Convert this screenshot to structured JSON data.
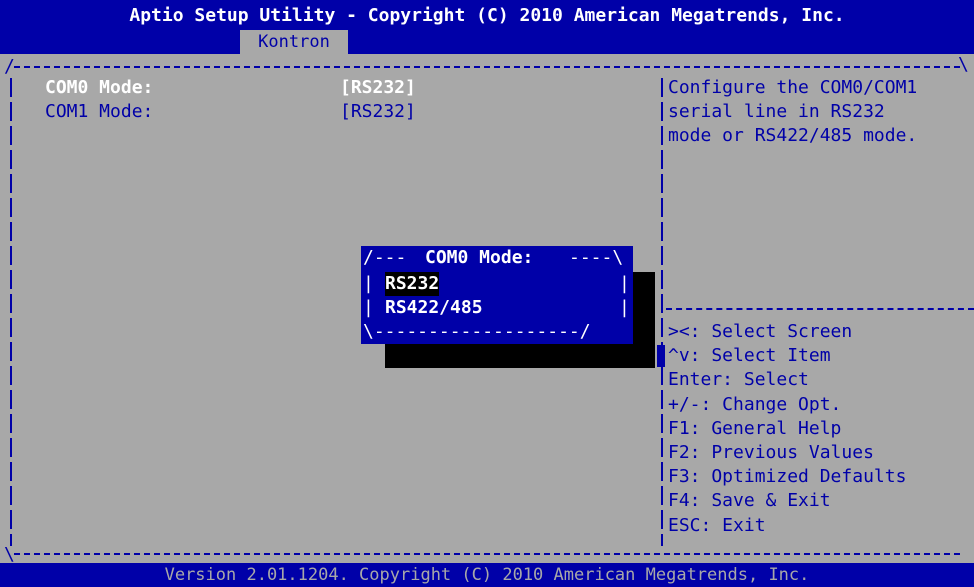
{
  "header": {
    "title": "Aptio Setup Utility - Copyright (C) 2010 American Megatrends, Inc.",
    "tab": "Kontron"
  },
  "settings": [
    {
      "label": "COM0 Mode:",
      "value": "[RS232]"
    },
    {
      "label": "COM1 Mode:",
      "value": "[RS232]"
    }
  ],
  "help": {
    "lines": [
      "Configure the COM0/COM1",
      "serial line in RS232",
      "mode or RS422/485 mode."
    ]
  },
  "keys": [
    "><: Select Screen",
    "^v: Select Item",
    "Enter: Select",
    "+/-: Change Opt.",
    "F1: General Help",
    "F2: Previous Values",
    "F3: Optimized Defaults",
    "F4: Save & Exit",
    "ESC: Exit"
  ],
  "popup": {
    "title": "COM0 Mode:",
    "options": [
      "RS232",
      "RS422/485"
    ],
    "selected": "RS232"
  },
  "footer": "Version 2.01.1204. Copyright (C) 2010 American Megatrends, Inc.",
  "colors": {
    "background": "#a8a8a8",
    "primary": "#0000a8",
    "highlight": "#ffffff"
  }
}
